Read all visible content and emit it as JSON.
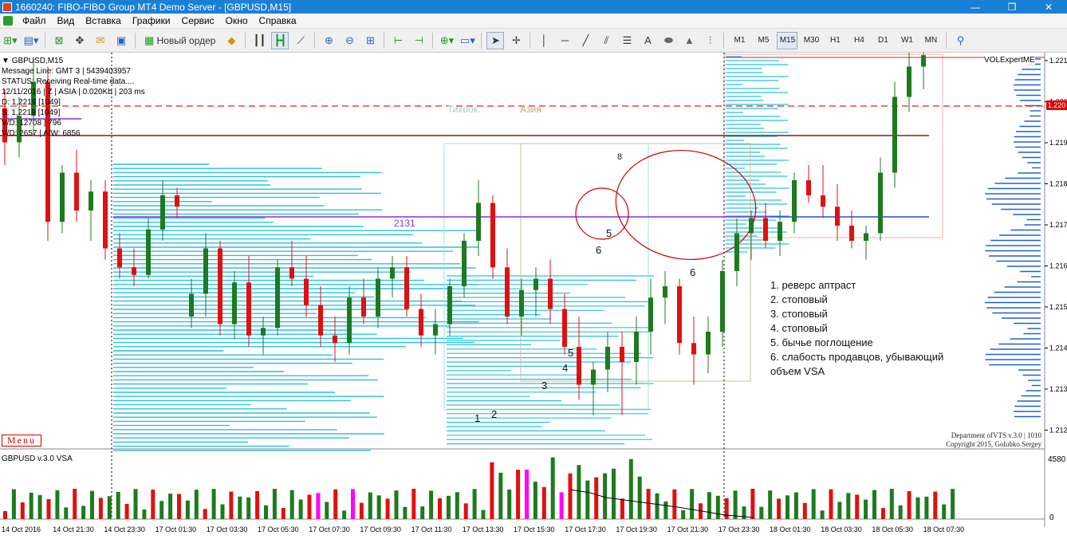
{
  "window": {
    "title": "1660240: FIBO-FIBO Group MT4 Demo Server - [GBPUSD,M15]",
    "buttons": [
      "—",
      "❐",
      "✕"
    ]
  },
  "menu": {
    "items": [
      "Файл",
      "Вид",
      "Вставка",
      "Графики",
      "Сервис",
      "Окно",
      "Справка"
    ]
  },
  "toolbar": {
    "new_order_label": "Новый ордер",
    "timeframes": [
      "M1",
      "M5",
      "M15",
      "M30",
      "H1",
      "H4",
      "D1",
      "W1",
      "MN"
    ],
    "active_timeframe": "M15",
    "text_tool_label": "A"
  },
  "chart": {
    "symbol_header": "GBPUSD,M15",
    "info_lines": [
      "Message Line: GMT 3 | 5439403957",
      "STATUS:  Receiving Real-time data....",
      "12/11/2016 | Z | ASIA | 0.020Kb | 203 ms",
      "D: 1,2219  [1049]",
      "S: 1,2219  [1049]",
      "V/D: 12708 | 796",
      "V/D: 2657 | A/W: 6856"
    ],
    "session_labels": {
      "tokyo": "Тихоок.",
      "asia": "Азия"
    },
    "level_label": "2131",
    "menu_button": "Menu",
    "indicator_name": "VOLExpertME",
    "current_price": "1.220",
    "price_ticks": [
      "1.221",
      "1.220",
      "1.219",
      "1.218",
      "1.217",
      "1.216",
      "1.215",
      "1.214",
      "1.213",
      "1.212"
    ],
    "credits": [
      "Department ofVTS  v.3.0 | 1010",
      "Copyright 2015, Golubko Sergey"
    ],
    "annotations": [
      "1",
      "2",
      "3",
      "4",
      "5",
      "5",
      "6",
      "6",
      "8"
    ],
    "legend": [
      "1. реверс аптраст",
      "2. стоповый",
      "3. стоповый",
      "4. стоповый",
      "5. бычье поглощение",
      "6. слабость продавцов, убывающий",
      "объем VSA"
    ],
    "volume_panel": {
      "title": "GBPUSD v.3.0 VSA",
      "max_label": "4580",
      "zero_label": "0"
    },
    "time_ticks": [
      "14 Oct 2016",
      "14 Oct 21:30",
      "14 Oct 23:30",
      "17 Oct 01:30",
      "17 Oct 03:30",
      "17 Oct 05:30",
      "17 Oct 07:30",
      "17 Oct 09:30",
      "17 Oct 11:30",
      "17 Oct 13:30",
      "17 Oct 15:30",
      "17 Oct 17:30",
      "17 Oct 19:30",
      "17 Oct 21:30",
      "17 Oct 23:30",
      "18 Oct 01:30",
      "18 Oct 03:30",
      "18 Oct 05:30",
      "18 Oct 07:30"
    ],
    "colors": {
      "bull": "#1e7a1e",
      "bear": "#e01010",
      "profile": "#29c0e0",
      "level": "#8a2be2",
      "support": "#1e50d0",
      "resistance": "#8b1a1a",
      "climax": "#ff00ff"
    }
  },
  "chart_data": {
    "type": "candlestick",
    "symbol": "GBPUSD",
    "timeframe": "M15",
    "ylim": [
      1.2118,
      1.2218
    ],
    "candles": [
      [
        1.2205,
        1.221,
        1.219,
        1.2196
      ],
      [
        1.2196,
        1.2208,
        1.2192,
        1.2203
      ],
      [
        1.2203,
        1.2218,
        1.2198,
        1.2212
      ],
      [
        1.2212,
        1.2216,
        1.217,
        1.2175
      ],
      [
        1.2175,
        1.219,
        1.2172,
        1.2188
      ],
      [
        1.2188,
        1.2194,
        1.2175,
        1.2178
      ],
      [
        1.2178,
        1.2186,
        1.217,
        1.2183
      ],
      [
        1.2183,
        1.2186,
        1.2165,
        1.2168
      ],
      [
        1.2168,
        1.2172,
        1.216,
        1.2163
      ],
      [
        1.2163,
        1.2168,
        1.2158,
        1.2161
      ],
      [
        1.2161,
        1.2176,
        1.216,
        1.2173
      ],
      [
        1.2173,
        1.2186,
        1.217,
        1.2182
      ],
      [
        1.2182,
        1.2184,
        1.2176,
        1.2179
      ],
      [
        1.215,
        1.216,
        1.2147,
        1.2156
      ],
      [
        1.2156,
        1.2172,
        1.215,
        1.2168
      ],
      [
        1.2168,
        1.217,
        1.2145,
        1.2148
      ],
      [
        1.2148,
        1.2162,
        1.2144,
        1.2159
      ],
      [
        1.2159,
        1.2166,
        1.2142,
        1.2145
      ],
      [
        1.2145,
        1.215,
        1.214,
        1.2147
      ],
      [
        1.2147,
        1.2165,
        1.2145,
        1.2163
      ],
      [
        1.2163,
        1.217,
        1.2158,
        1.216
      ],
      [
        1.216,
        1.2166,
        1.215,
        1.2153
      ],
      [
        1.2153,
        1.2158,
        1.2142,
        1.2145
      ],
      [
        1.2145,
        1.215,
        1.2138,
        1.2143
      ],
      [
        1.2143,
        1.2158,
        1.214,
        1.2155
      ],
      [
        1.2155,
        1.216,
        1.2148,
        1.215
      ],
      [
        1.215,
        1.2163,
        1.2147,
        1.216
      ],
      [
        1.216,
        1.2166,
        1.2155,
        1.2163
      ],
      [
        1.2163,
        1.2166,
        1.215,
        1.2152
      ],
      [
        1.2152,
        1.2156,
        1.2142,
        1.2145
      ],
      [
        1.2145,
        1.2152,
        1.214,
        1.2148
      ],
      [
        1.2148,
        1.216,
        1.2145,
        1.2158
      ],
      [
        1.2158,
        1.2172,
        1.2155,
        1.217
      ],
      [
        1.217,
        1.2186,
        1.2166,
        1.218
      ],
      [
        1.218,
        1.2182,
        1.216,
        1.2163
      ],
      [
        1.2163,
        1.2168,
        1.2148,
        1.215
      ],
      [
        1.215,
        1.216,
        1.2145,
        1.2157
      ],
      [
        1.2157,
        1.2163,
        1.215,
        1.216
      ],
      [
        1.216,
        1.2165,
        1.2148,
        1.2152
      ],
      [
        1.2152,
        1.2156,
        1.214,
        1.2142
      ],
      [
        1.2142,
        1.215,
        1.2128,
        1.2132
      ],
      [
        1.2132,
        1.2138,
        1.2124,
        1.2136
      ],
      [
        1.2136,
        1.2146,
        1.213,
        1.2142
      ],
      [
        1.2142,
        1.2146,
        1.2124,
        1.2138
      ],
      [
        1.2138,
        1.215,
        1.2132,
        1.2146
      ],
      [
        1.2146,
        1.216,
        1.214,
        1.2155
      ],
      [
        1.2155,
        1.2162,
        1.2148,
        1.2158
      ],
      [
        1.2158,
        1.216,
        1.214,
        1.2143
      ],
      [
        1.2143,
        1.215,
        1.2132,
        1.214
      ],
      [
        1.214,
        1.215,
        1.2135,
        1.2146
      ],
      [
        1.2146,
        1.2165,
        1.2142,
        1.2162
      ],
      [
        1.2162,
        1.2176,
        1.2158,
        1.2172
      ],
      [
        1.2172,
        1.2178,
        1.2165,
        1.2176
      ],
      [
        1.2176,
        1.218,
        1.2168,
        1.217
      ],
      [
        1.217,
        1.2178,
        1.2166,
        1.2175
      ],
      [
        1.2175,
        1.2188,
        1.2172,
        1.2186
      ],
      [
        1.2186,
        1.219,
        1.218,
        1.2182
      ],
      [
        1.2182,
        1.219,
        1.2176,
        1.2179
      ],
      [
        1.2179,
        1.2185,
        1.217,
        1.2174
      ],
      [
        1.2174,
        1.2178,
        1.2168,
        1.217
      ],
      [
        1.217,
        1.2174,
        1.2165,
        1.2172
      ],
      [
        1.2172,
        1.2192,
        1.217,
        1.2188
      ],
      [
        1.2188,
        1.2212,
        1.2184,
        1.2208
      ],
      [
        1.2208,
        1.222,
        1.2204,
        1.2216
      ],
      [
        1.2216,
        1.2222,
        1.221,
        1.2219
      ]
    ]
  }
}
